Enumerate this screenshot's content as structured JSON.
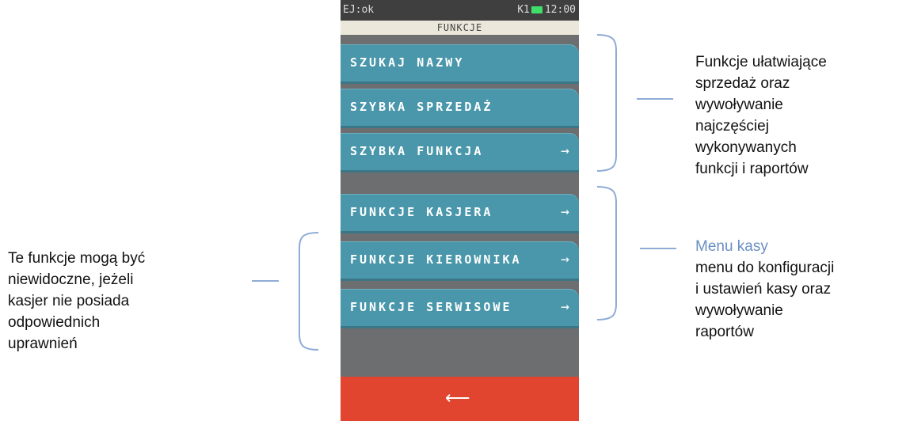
{
  "statusbar": {
    "left": "EJ:ok",
    "indicator": "K1",
    "time": "12:00"
  },
  "screen_title": "FUNKCJE",
  "menu": [
    {
      "label": "SZUKAJ NAZWY",
      "arrow": ""
    },
    {
      "label": "SZYBKA SPRZEDAŻ",
      "arrow": ""
    },
    {
      "label": "SZYBKA FUNKCJA",
      "arrow": "→"
    },
    {
      "label": "FUNKCJE KASJERA",
      "arrow": "→"
    },
    {
      "label": "FUNKCJE KIEROWNIKA",
      "arrow": "→"
    },
    {
      "label": "FUNKCJE SERWISOWE",
      "arrow": "→"
    }
  ],
  "back_symbol": "⟵",
  "annotations": {
    "left": [
      "Te funkcje mogą być",
      "niewidoczne, jeżeli",
      "kasjer nie posiada",
      "odpowiednich",
      "uprawnień"
    ],
    "right_top": [
      "Funkcje ułatwiające",
      "sprzedaż oraz",
      "wywoływanie",
      "najczęściej",
      "wykonywanych",
      "funkcji i raportów"
    ],
    "right_bottom_heading": "Menu kasy",
    "right_bottom": [
      "menu do konfiguracji",
      "i ustawień kasy oraz",
      "wywoływanie",
      "raportów"
    ]
  },
  "colors": {
    "menu": "#4a97ab",
    "back_bar": "#e2452f",
    "bracket": "#8eacd6",
    "heading": "#6a8fc4"
  },
  "icons": [
    "battery-icon",
    "arrow-right-icon",
    "back-arrow-icon"
  ]
}
